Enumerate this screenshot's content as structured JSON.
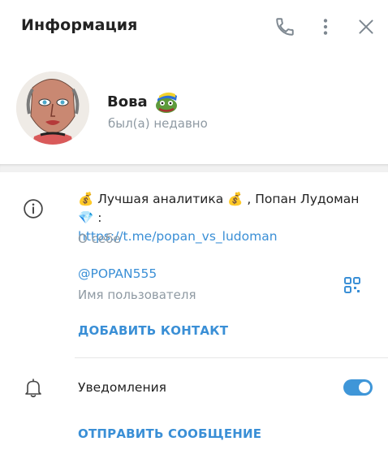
{
  "header": {
    "title": "Информация",
    "icons": [
      "phone-icon",
      "more-vertical-icon",
      "close-icon"
    ]
  },
  "profile": {
    "name": "Вова",
    "status": "был(а) недавно",
    "sticker": "pepe-frog-sticker"
  },
  "bio": {
    "text_start": "💰 Лучшая аналитика 💰 , Попан Лудоман 💎 :",
    "link": "https://t.me/popan_vs_ludoman",
    "label": "О себе"
  },
  "username": {
    "value": "@POPAN555",
    "label": "Имя пользователя"
  },
  "actions": {
    "add_contact": "ДОБАВИТЬ КОНТАКТ",
    "send_message": "ОТПРАВИТЬ СООБЩЕНИЕ"
  },
  "notifications": {
    "label": "Уведомления",
    "enabled": true
  },
  "colors": {
    "accent": "#3a8fd6",
    "muted_text": "#8f9aa3",
    "toggle_on": "#3f96d8"
  }
}
